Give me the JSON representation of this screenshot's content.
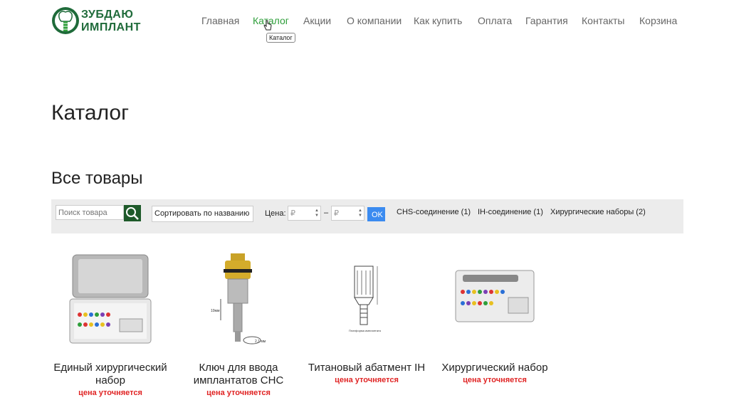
{
  "logo": {
    "line1": "ЗУБДАЮ",
    "line2": "ИМПЛАНТ"
  },
  "nav": [
    {
      "label": "Главная"
    },
    {
      "label": "Каталог"
    },
    {
      "label": "Акции"
    },
    {
      "label": "О компании"
    },
    {
      "label": "Как купить"
    },
    {
      "label": "Оплата"
    },
    {
      "label": "Гарантия"
    },
    {
      "label": "Контакты"
    },
    {
      "label": "Корзина"
    }
  ],
  "tooltip": "Каталог",
  "page_title": "Каталог",
  "section_title": "Все товары",
  "filter": {
    "search_placeholder": "Поиск товара",
    "sort_label": "Сортировать по названию",
    "price_label": "Цена:",
    "price_from_placeholder": "₽",
    "price_to_placeholder": "₽",
    "dash": "–",
    "ok_label": "OK",
    "categories": [
      {
        "label": "CHS-соединение (1)"
      },
      {
        "label": "IH-соединение (1)"
      },
      {
        "label": "Хирургические наборы (2)"
      }
    ]
  },
  "products": [
    {
      "name": "Единый хирургический набор",
      "price": "цена уточняется"
    },
    {
      "name": "Ключ для ввода имплантатов CHC",
      "price": "цена уточняется"
    },
    {
      "name": "Титановый абатмент IH",
      "price": "цена уточняется"
    },
    {
      "name": "Хирургический набор",
      "price": "цена уточняется"
    }
  ],
  "colors": {
    "accent": "#2e9e3a",
    "brand": "#1f6b3a",
    "price": "#e02424",
    "ok": "#3b8bf0",
    "filter_bg": "#ececec"
  }
}
